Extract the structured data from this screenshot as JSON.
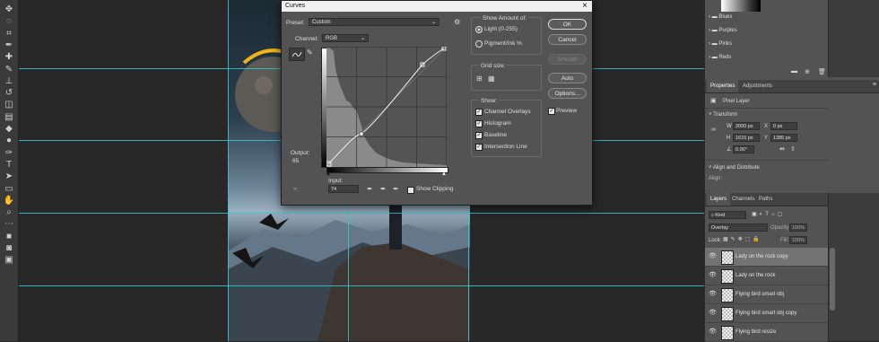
{
  "toolbar": {
    "tools": [
      "move-tool",
      "lasso-tool",
      "crop-tool",
      "eyedropper-tool",
      "healing-tool",
      "brush-tool",
      "stamp-tool",
      "history-brush-tool",
      "eraser-tool",
      "gradient-tool",
      "blur-tool",
      "dodge-tool",
      "pen-tool",
      "type-tool",
      "path-selection-tool",
      "rectangle-tool",
      "hand-tool",
      "zoom-tool",
      "more-tools",
      "color-swatches",
      "quick-mask",
      "screen-mode"
    ],
    "type_glyph": "T"
  },
  "curves": {
    "title": "Curves",
    "preset_label": "Preset:",
    "preset_value": "Custom",
    "channel_label": "Channel:",
    "channel_value": "RGB",
    "output_label": "Output:",
    "output_value": "65",
    "input_label": "Input:",
    "input_value": "74",
    "show_clipping": "Show Clipping",
    "buttons": {
      "ok": "OK",
      "cancel": "Cancel",
      "smooth": "Smooth",
      "auto": "Auto",
      "options": "Options..."
    },
    "preview_label": "Preview",
    "preview_checked": true,
    "show_amount_of": "Show Amount of:",
    "light_option": "Light  (0-255)",
    "pigment_option": "Pigment/Ink %",
    "grid_size": "Grid size:",
    "show": "Show:",
    "show_options": [
      {
        "label": "Channel Overlays",
        "checked": true
      },
      {
        "label": "Histogram",
        "checked": true
      },
      {
        "label": "Baseline",
        "checked": true
      },
      {
        "label": "Intersection Line",
        "checked": true
      }
    ]
  },
  "right": {
    "swatch_groups": [
      "Blues",
      "Purples",
      "Pinks",
      "Reds"
    ],
    "properties_tab": "Properties",
    "adjustments_tab": "Adjustments",
    "pixel_layer": "Pixel Layer",
    "transform": "Transform",
    "w_label": "W",
    "w_value": "2000 px",
    "h_label": "H",
    "h_value": "1615 px",
    "x_label": "X",
    "x_value": "0 px",
    "y_label": "Y",
    "y_value": "1385 px",
    "angle_value": "0.00°",
    "align_distribute": "Align and Distribute",
    "align_label": "Align:",
    "layers_tab": "Layers",
    "channels_tab": "Channels",
    "paths_tab": "Paths",
    "kind_value": "Kind",
    "blend_mode": "Overlay",
    "opacity_label": "Opacity:",
    "opacity_value": "100%",
    "lock_label": "Lock:",
    "fill_label": "Fill:",
    "fill_value": "100%",
    "layers": [
      {
        "name": "Lady on the rock copy",
        "selected": true
      },
      {
        "name": "Lady on the rock",
        "selected": false
      },
      {
        "name": "Flying bird smart obj",
        "selected": false
      },
      {
        "name": "Flying bird smart obj copy",
        "selected": false
      },
      {
        "name": "Flying bird resize",
        "selected": false
      }
    ]
  }
}
